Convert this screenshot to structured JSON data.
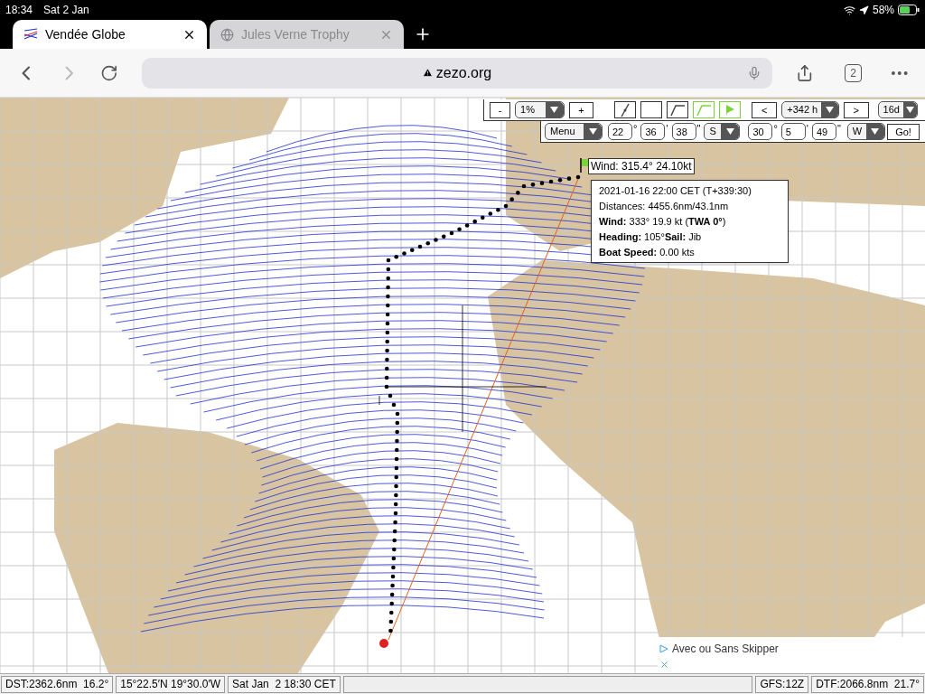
{
  "status_bar": {
    "time": "18:34",
    "date": "Sat 2 Jan",
    "battery": "58%"
  },
  "tabs": [
    {
      "title": "Vendée Globe",
      "selected": true
    },
    {
      "title": "Jules Verne Trophy",
      "selected": false
    }
  ],
  "address_bar": {
    "url": "zezo.org"
  },
  "tab_count": "2",
  "toolbar": {
    "zoom_out": "-",
    "zoom": "1%",
    "zoom_in": "+",
    "tools": [
      {
        "kind": "segment",
        "selected": false
      },
      {
        "kind": "blank",
        "selected": false
      },
      {
        "kind": "polyline",
        "selected": false
      },
      {
        "kind": "polyline",
        "selected": true
      },
      {
        "kind": "flag",
        "selected": true
      }
    ],
    "prev": "<",
    "time_offset": "+342 h",
    "next": ">",
    "range": "16d",
    "menu": "Menu",
    "latitude": [
      {
        "value": "22",
        "unit": "°"
      },
      {
        "value": "36",
        "unit": "'"
      },
      {
        "value": "38",
        "unit": "\""
      }
    ],
    "lat_hemisphere": "S",
    "longitude": [
      {
        "value": "30",
        "unit": "°"
      },
      {
        "value": "5",
        "unit": "'"
      },
      {
        "value": "49",
        "unit": "\""
      }
    ],
    "lon_hemisphere": "W",
    "go": "Go!"
  },
  "wind_label": "Wind: 315.4° 24.10kt",
  "info_popup": [
    "2021-01-16 22:00 CET (T+339:30)",
    "Distances: 4455.6nm/43.1nm",
    "**Wind:** 333° 19.9 kt (**TWA 0°**)",
    "**Heading:** 105°**Sail:** Jib",
    "**Boat Speed:** 0.00 kts"
  ],
  "ad": "Avec ou Sans Skipper",
  "footer": {
    "left": [
      "DST:2362.6nm  16.2°",
      "15°22.5′N 19°30.0′W",
      "Sat Jan  2 18:30 CET"
    ],
    "right": [
      "GFS:12Z",
      "DTF:2066.8nm  21.7°"
    ]
  }
}
